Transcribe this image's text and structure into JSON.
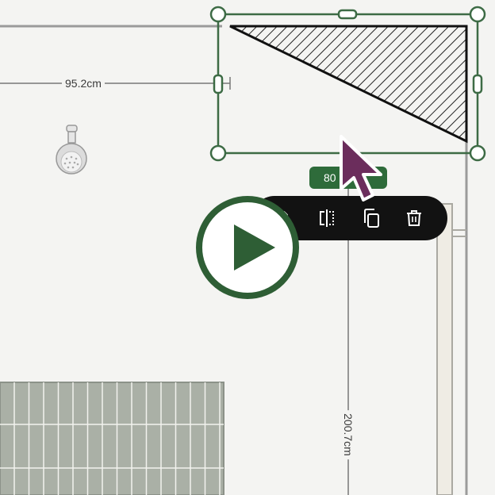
{
  "canvas": {
    "background": "#f4f4f2",
    "wall_color": "#9a9a9a",
    "selection_color": "#3d6b45",
    "tile_color": "#aab0a6"
  },
  "dimensions": {
    "horizontal": "95.2cm",
    "vertical": "200.7cm"
  },
  "selection": {
    "size_badge": "80"
  },
  "toolbar": {
    "edit_icon": "pencil-icon",
    "flip_icon": "flip-horizontal-icon",
    "duplicate_icon": "duplicate-icon",
    "delete_icon": "trash-icon"
  },
  "fixtures": {
    "shower_icon": "shower-head-icon"
  },
  "overlay": {
    "play_icon": "play-icon",
    "play_color": "#2e5e35"
  },
  "cursor": {
    "icon": "cursor-arrow-icon",
    "color": "#6b2d5c"
  }
}
